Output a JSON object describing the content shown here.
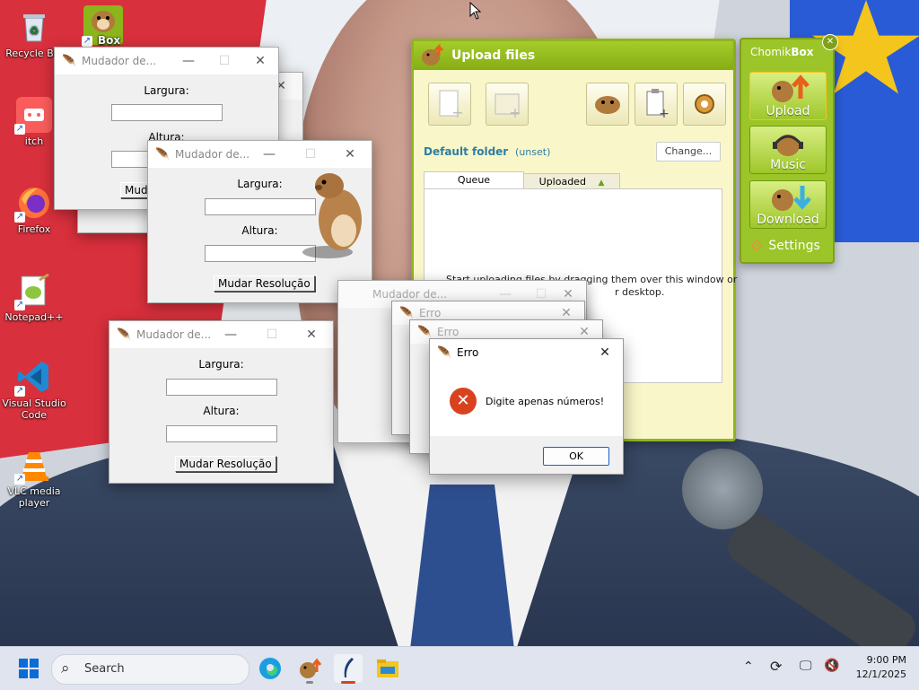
{
  "desktop": {
    "icons": [
      {
        "label": "Recycle Bin",
        "name": "recycle-bin"
      },
      {
        "label": "itch",
        "name": "itch"
      },
      {
        "label": "Firefox",
        "name": "firefox"
      },
      {
        "label": "Notepad++",
        "name": "notepad-plus-plus"
      },
      {
        "label": "Visual Studio Code",
        "name": "vscode"
      },
      {
        "label": "VLC media player",
        "name": "vlc"
      }
    ],
    "chomikbox_icon_label": "Box"
  },
  "resizer_windows": {
    "title": "Mudador de...",
    "width_label": "Largura:",
    "height_label": "Altura:",
    "button_label": "Mudar Resolução",
    "button_partial": "Mud",
    "ghost_title": "Mudador de..."
  },
  "error_dialogs": {
    "title": "Erro",
    "message": "Digite apenas números!",
    "ok_label": "OK"
  },
  "upload_window": {
    "title": "Upload files",
    "default_folder_label": "Default folder",
    "default_folder_value": "(unset)",
    "change_button": "Change...",
    "tabs": [
      "Queue",
      "Uploaded"
    ],
    "hint_line1": "Start uploading files by dragging them over this window or",
    "hint_line2": "r desktop."
  },
  "chomik_panel": {
    "brand_part1": "Chomik",
    "brand_part2": "Box",
    "upload": "Upload",
    "music": "Music",
    "download": "Download",
    "settings": "Settings"
  },
  "taskbar": {
    "search_label": "Search",
    "time": "9:00 PM",
    "date": "12/1/2025"
  },
  "colors": {
    "chomik_green": "#9cc52a",
    "error_red": "#d9421f",
    "accent_blue": "#1a5fd0"
  }
}
